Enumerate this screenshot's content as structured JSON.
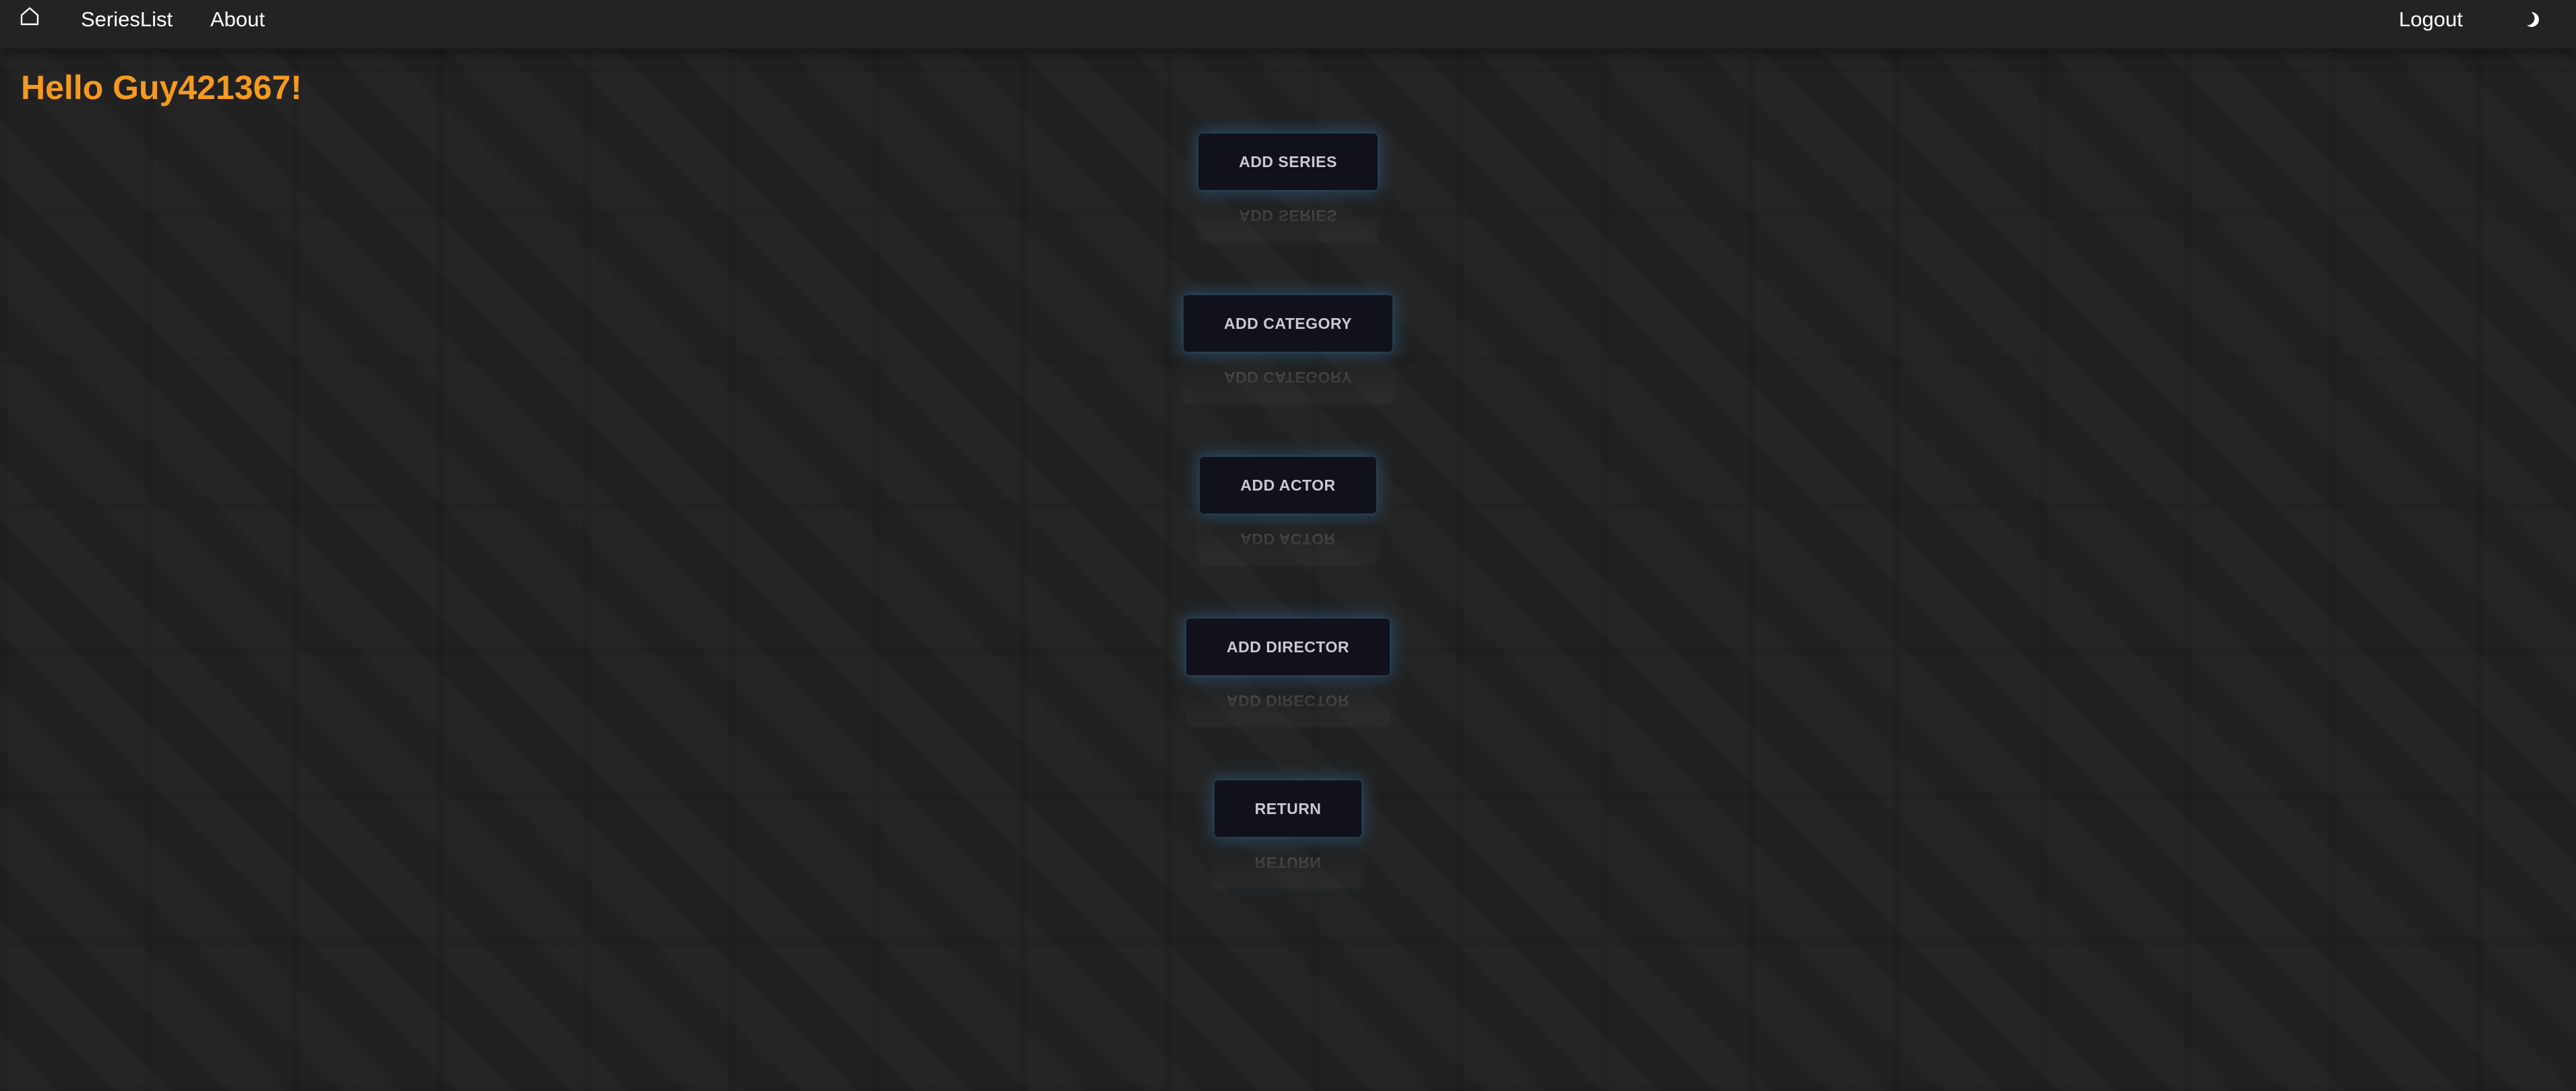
{
  "navbar": {
    "home_icon": "home-icon",
    "links": {
      "series_list": "SeriesList",
      "about": "About",
      "logout": "Logout"
    },
    "theme_icon": "moon-icon"
  },
  "greeting": "Hello Guy421367!",
  "actions": [
    {
      "label": "ADD SERIES"
    },
    {
      "label": "ADD CATEGORY"
    },
    {
      "label": "ADD ACTOR"
    },
    {
      "label": "ADD DIRECTOR"
    },
    {
      "label": "RETURN"
    }
  ],
  "colors": {
    "background": "#222222",
    "greeting": "#f59a1f",
    "button_bg": "#11111c",
    "button_text": "#c9c9d6",
    "button_glow": "#306996"
  }
}
